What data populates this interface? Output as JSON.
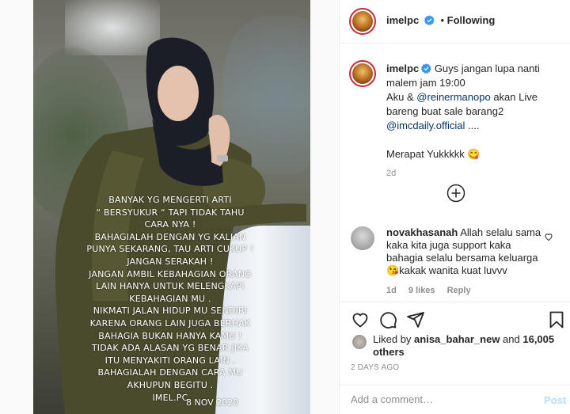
{
  "header": {
    "username": "imelpc",
    "follow_separator": "•",
    "follow_label": "Following"
  },
  "media": {
    "story_lines": [
      "BANYAK YG MENGERTI ARTI",
      "“ BERSYUKUR “ TAPI TIDAK TAHU",
      "CARA NYA !",
      "BAHAGIALAH DENGAN YG KALIAN",
      "PUNYA SEKARANG, TAU ARTI CUKUP !",
      "JANGAN SERAKAH !",
      "JANGAN AMBIL KEBAHAGIAN ORANG",
      "LAIN HANYA UNTUK MELENGKAPI",
      "KEBAHAGIAN MU .",
      "NIKMATI JALAN HIDUP MU SENDIRI",
      "KARENA ORANG LAIN JUGA BERHAK",
      "BAHAGIA BUKAN HANYA KAMU !",
      "TIDAK ADA ALASAN YG BENAR JIKA",
      "ITU MENYAKITI ORANG LAIN .",
      "BAHAGIALAH DENGAN CARA MU",
      "AKHUPUN BEGITU .",
      "IMEL.PC"
    ],
    "story_date": "8 NOV 2020"
  },
  "caption": {
    "username": "imelpc",
    "text_1": "Guys jangan lupa nanti malem jam 19:00",
    "text_2a": "Aku & ",
    "mention_1": "@reinermanopo",
    "text_2b": " akan Live bareng buat sale barang2 ",
    "mention_2": "@imcdaily.official",
    "text_2c": " ....",
    "text_3": "Merapat Yukkkkk 😋",
    "time": "2d"
  },
  "comment": {
    "username": "novakhasanah",
    "text": " Allah selalu sama kaka kita juga support kaka bahagia selalu bersama keluarga 😘kakak wanita kuat luvvv",
    "time": "1d",
    "likes": "9 likes",
    "reply": "Reply"
  },
  "likes": {
    "prefix": "Liked by ",
    "user": "anisa_bahar_new",
    "middle": " and ",
    "count": "16,005 others"
  },
  "date": "2 DAYS AGO",
  "add_comment": {
    "placeholder": "Add a comment…",
    "post_label": "Post"
  },
  "colors": {
    "verified": "#3897f0",
    "link": "#00376b",
    "post_button": "#b2dffc"
  }
}
